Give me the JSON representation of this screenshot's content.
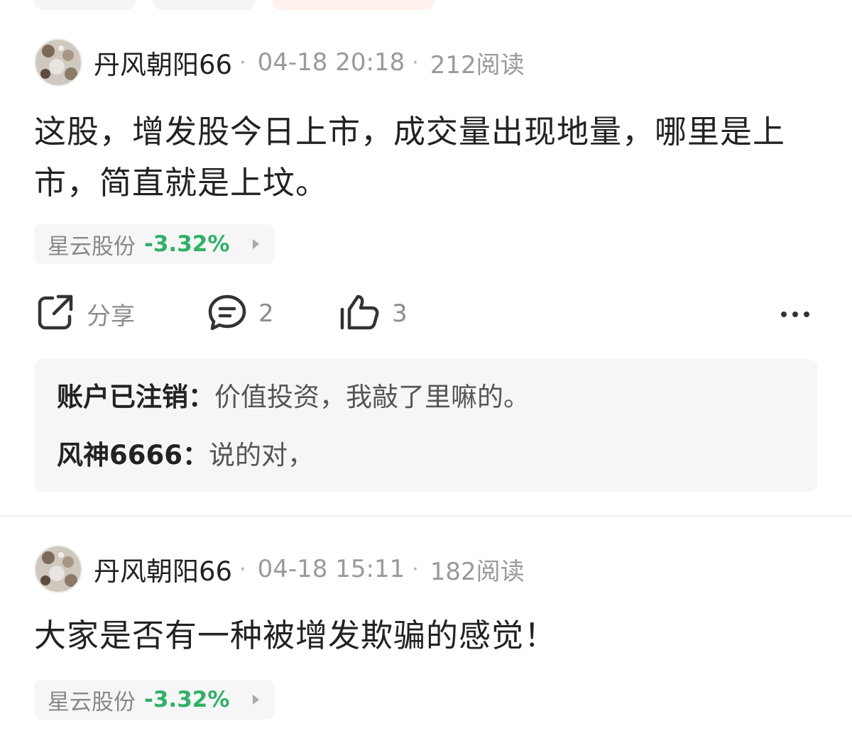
{
  "posts": [
    {
      "author": "丹风朝阳66",
      "time": "04-18 20:18",
      "reads": "212阅读",
      "content": "这股，增发股今日上市，成交量出现地量，哪里是上市，简直就是上坟。",
      "stock": {
        "name": "星云股份",
        "change": "-3.32%"
      },
      "actions": {
        "share_label": "分享",
        "comment_count": "2",
        "like_count": "3"
      },
      "replies": [
        {
          "author": "账户已注销：",
          "text": "价值投资，我敲了里嘛的。"
        },
        {
          "author": "风神6666：",
          "text": "说的对，"
        }
      ]
    },
    {
      "author": "丹风朝阳66",
      "time": "04-18 15:11",
      "reads": "182阅读",
      "content": "大家是否有一种被增发欺骗的感觉！",
      "stock": {
        "name": "星云股份",
        "change": "-3.32%"
      }
    }
  ],
  "colors": {
    "stock_down": "#2fb068",
    "meta_text": "#9a9a9a",
    "reply_bg": "#f6f6f8"
  },
  "icons": [
    "share-icon",
    "comment-icon",
    "thumbs-up-icon",
    "more-icon",
    "chevron-right-icon"
  ]
}
